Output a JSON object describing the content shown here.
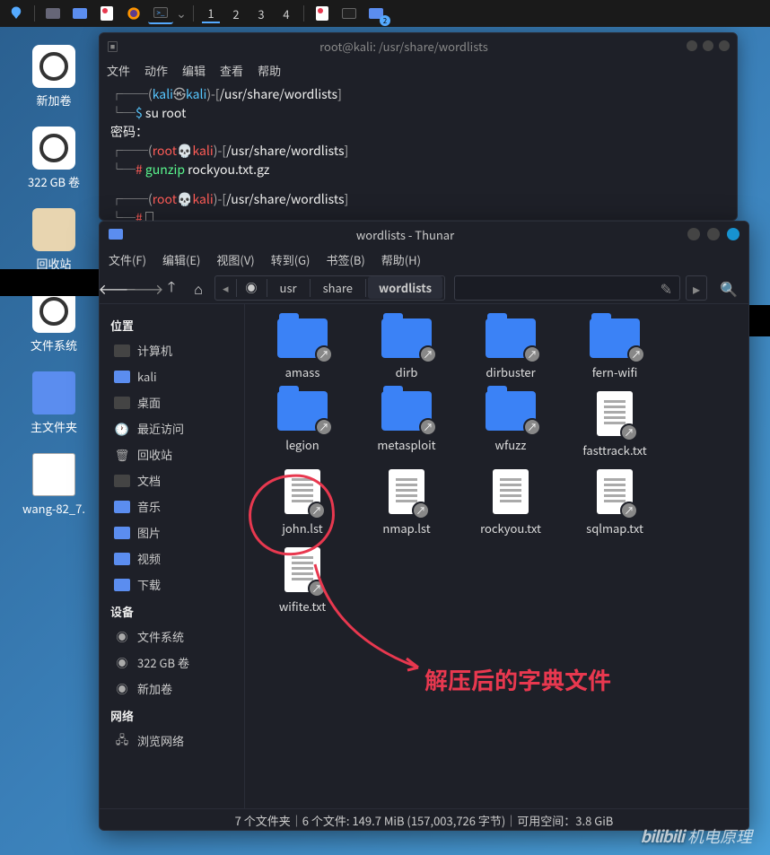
{
  "taskbar": {
    "workspaces": [
      "1",
      "2",
      "3",
      "4"
    ],
    "active_workspace": 0,
    "app_badge": "2"
  },
  "desktop": {
    "icons": [
      {
        "label": "新加卷",
        "type": "disk"
      },
      {
        "label": "322 GB 卷",
        "type": "disk"
      },
      {
        "label": "回收站",
        "type": "trash"
      },
      {
        "label": "文件系统",
        "type": "disk"
      },
      {
        "label": "主文件夹",
        "type": "folder"
      },
      {
        "label": "wang-82_7.",
        "type": "file"
      }
    ]
  },
  "terminal": {
    "title": "root@kali: /usr/share/wordlists",
    "menu": [
      "文件",
      "动作",
      "编辑",
      "查看",
      "帮助"
    ],
    "lines": {
      "user1": "kali",
      "sym": "㉿",
      "host": "kali",
      "path": "/usr/share/wordlists",
      "cmd1": "su root",
      "pw_label": "密码：",
      "root_user": "root",
      "root_sym": "💀",
      "cmd2": "gunzip rockyou.txt.gz"
    }
  },
  "thunar": {
    "title": "wordlists - Thunar",
    "menu": [
      "文件(F)",
      "编辑(E)",
      "视图(V)",
      "转到(G)",
      "书签(B)",
      "帮助(H)"
    ],
    "path": {
      "segments": [
        "usr",
        "share",
        "wordlists"
      ],
      "active_idx": 2
    },
    "sidebar": {
      "sections": [
        {
          "heading": "位置",
          "items": [
            {
              "label": "计算机",
              "ico": "computer"
            },
            {
              "label": "kali",
              "ico": "home"
            },
            {
              "label": "桌面",
              "ico": "desktop"
            },
            {
              "label": "最近访问",
              "ico": "recent"
            },
            {
              "label": "回收站",
              "ico": "trash"
            },
            {
              "label": "文档",
              "ico": "docs"
            },
            {
              "label": "音乐",
              "ico": "music"
            },
            {
              "label": "图片",
              "ico": "pics"
            },
            {
              "label": "视频",
              "ico": "video"
            },
            {
              "label": "下载",
              "ico": "download"
            }
          ]
        },
        {
          "heading": "设备",
          "items": [
            {
              "label": "文件系统",
              "ico": "fs"
            },
            {
              "label": "322 GB 卷",
              "ico": "disk"
            },
            {
              "label": "新加卷",
              "ico": "disk"
            }
          ]
        },
        {
          "heading": "网络",
          "items": [
            {
              "label": "浏览网络",
              "ico": "net"
            }
          ]
        }
      ]
    },
    "files": [
      {
        "name": "amass",
        "type": "folder",
        "link": true
      },
      {
        "name": "dirb",
        "type": "folder",
        "link": true
      },
      {
        "name": "dirbuster",
        "type": "folder",
        "link": true
      },
      {
        "name": "fern-wifi",
        "type": "folder",
        "link": true
      },
      {
        "name": "legion",
        "type": "folder",
        "link": true
      },
      {
        "name": "metasploit",
        "type": "folder",
        "link": true
      },
      {
        "name": "wfuzz",
        "type": "folder",
        "link": true
      },
      {
        "name": "fasttrack.txt",
        "type": "text",
        "link": true
      },
      {
        "name": "john.lst",
        "type": "text",
        "link": true
      },
      {
        "name": "nmap.lst",
        "type": "text",
        "link": true
      },
      {
        "name": "rockyou.txt",
        "type": "text",
        "link": false
      },
      {
        "name": "sqlmap.txt",
        "type": "text",
        "link": true
      },
      {
        "name": "wifite.txt",
        "type": "text",
        "link": true
      }
    ],
    "annotation": "解压后的字典文件",
    "statusbar": "7 个文件夹｜6 个文件: 149.7 MiB (157,003,726 字节)｜可用空间：3.8 GiB"
  },
  "watermark": {
    "logo": "bilibili",
    "text": "机电原理"
  }
}
